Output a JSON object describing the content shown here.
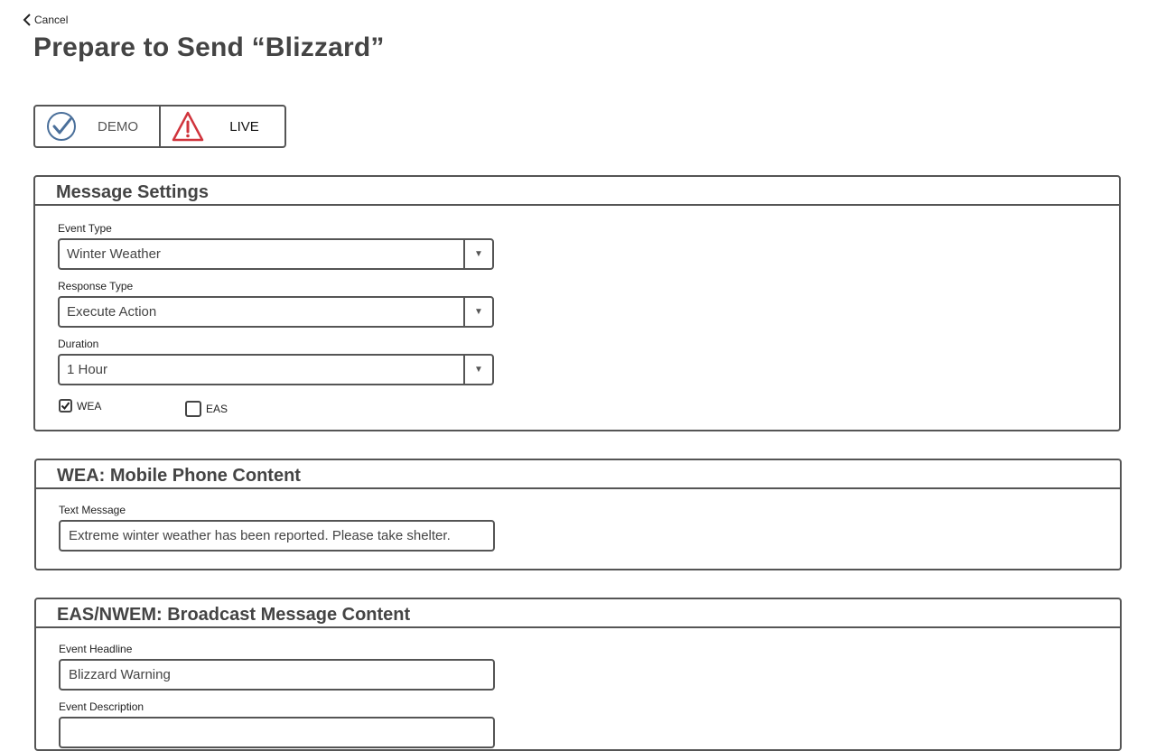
{
  "nav": {
    "cancel_label": "Cancel"
  },
  "page": {
    "title": "Prepare to Send “Blizzard”"
  },
  "mode_toggle": {
    "demo_label": "DEMO",
    "live_label": "LIVE",
    "selected": "DEMO"
  },
  "message_settings": {
    "heading": "Message Settings",
    "event_type": {
      "label": "Event Type",
      "value": "Winter Weather"
    },
    "response_type": {
      "label": "Response Type",
      "value": "Execute Action"
    },
    "duration": {
      "label": "Duration",
      "value": "1 Hour"
    },
    "channels": [
      {
        "label": "WEA",
        "checked": true
      },
      {
        "label": "EAS",
        "checked": false
      }
    ]
  },
  "wea": {
    "heading": "WEA: Mobile Phone Content",
    "text_message_label": "Text Message",
    "text_message_value": "Extreme winter weather has been reported. Please take shelter."
  },
  "eas": {
    "heading": "EAS/NWEM: Broadcast Message Content",
    "headline_label": "Event Headline",
    "headline_value": "Blizzard Warning",
    "description_label": "Event Description",
    "description_value": ""
  },
  "icons": {
    "back": "chevron-left-icon",
    "demo": "check-circle-icon",
    "live": "warning-triangle-icon",
    "dropdown": "caret-down-icon",
    "check": "checkmark-icon"
  },
  "colors": {
    "demo_icon": "#4a6f9a",
    "live_icon": "#d0343c",
    "border": "#555555"
  }
}
